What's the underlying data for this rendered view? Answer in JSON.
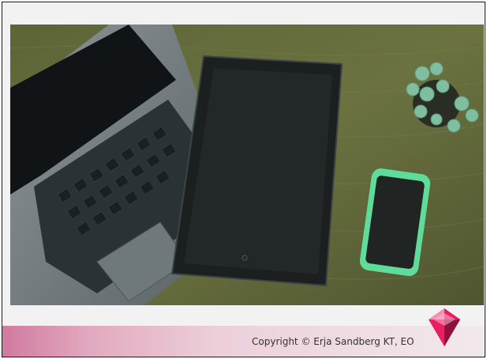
{
  "footer": {
    "copyright_text": "Copyright © Erja Sandberg KT, EO"
  },
  "logo": {
    "icon": "gem-icon",
    "colors": [
      "#c2185b",
      "#e91e63",
      "#f48fb1",
      "#8e1040"
    ]
  },
  "photo": {
    "subject": "laptop, tablet, smartphone and potted plant on wooden desk"
  },
  "theme": {
    "background": "#f2f2f2",
    "accent": "#d07aa0"
  }
}
